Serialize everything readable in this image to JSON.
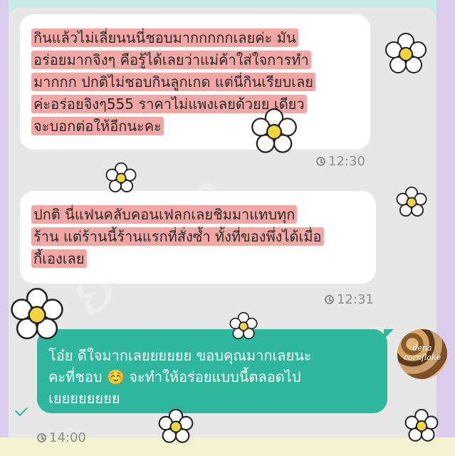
{
  "messages": [
    {
      "direction": "incoming",
      "lines": [
        "กินแล้วไม่เลี่ยนนนี่ชอบมากกกกกเลยค่ะ มัน",
        "อร่อยมากจิงๆ คือรู้ได้เลยว่าแม่ค้าใส่ใจการทำ",
        "มากกก ปกติไม่ชอบกินลูกเกด แต่นี่กินเรียบเลย",
        "ค่ะอร่อยจิงๆ555 ราคาไม่แพงเลยด้วยย เดียว",
        "จะบอกต่อให้อีกนะคะ"
      ],
      "time": "12:30"
    },
    {
      "direction": "incoming",
      "lines": [
        "ปกติ นี่แฟนคลับคอนเฟลกเลยชิมมาแทบทุก",
        "ร้าน แต่ร้านนี้ร้านแรกที่สั่งซ้ำ ทั้งที่ของพึ่งได้เมื่อ",
        "กี้เองเลย"
      ],
      "time": "12:31"
    },
    {
      "direction": "outgoing",
      "lines": [
        "โอ๋ย ดีใจมากเลยยยยยย ขอบคุณมากเลยนะ",
        "คะที่ชอบ ☺️ จะทำให้อร่อยแบบนี้ตลอดไป",
        "เยยยยยยยย"
      ],
      "time": "14:00",
      "read": true
    }
  ],
  "avatar": {
    "label_line1": "dena",
    "label_line2": "cornflake"
  },
  "colors": {
    "incoming_bubble": "#ffffff",
    "outgoing_bubble": "#2fb79d",
    "highlight": "#f3a7a4",
    "chat_background": "#e7e7e7"
  }
}
